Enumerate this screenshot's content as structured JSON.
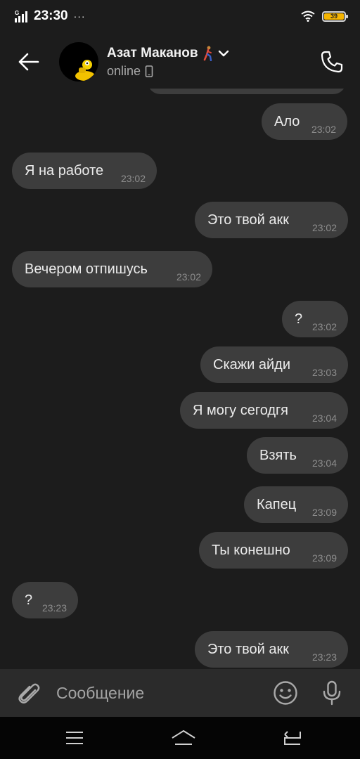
{
  "status_bar": {
    "network": "G",
    "time": "23:30",
    "more": "···",
    "battery": "39"
  },
  "header": {
    "contact_name": "Азат Маканов",
    "name_emoji_icon": "walking-person-icon",
    "status": "online",
    "status_icon": "phone-device-icon"
  },
  "messages": [
    {
      "side": "out",
      "text": "Ало",
      "time": "23:02"
    },
    {
      "side": "in",
      "text": "Я на работе",
      "time": "23:02"
    },
    {
      "side": "out",
      "text": "Это твой акк",
      "time": "23:02"
    },
    {
      "side": "in",
      "text": "Вечером отпишусь",
      "time": "23:02"
    },
    {
      "side": "out",
      "text": "?",
      "time": "23:02"
    },
    {
      "side": "out",
      "text": "Скажи айди",
      "time": "23:03"
    },
    {
      "side": "out",
      "text": "Я могу сегодгя",
      "time": "23:04"
    },
    {
      "side": "out",
      "text": "Взять",
      "time": "23:04"
    },
    {
      "side": "out",
      "text": "Капец",
      "time": "23:09"
    },
    {
      "side": "out",
      "text": "Ты конешно",
      "time": "23:09"
    },
    {
      "side": "in",
      "text": "?",
      "time": "23:23"
    },
    {
      "side": "out",
      "text": "Это твой акк",
      "time": "23:23"
    }
  ],
  "composer": {
    "placeholder": "Сообщение"
  },
  "colors": {
    "background": "#1c1c1c",
    "bubble": "#3d3d3d",
    "composer": "#2b2b2b",
    "battery": "#f5b400"
  }
}
